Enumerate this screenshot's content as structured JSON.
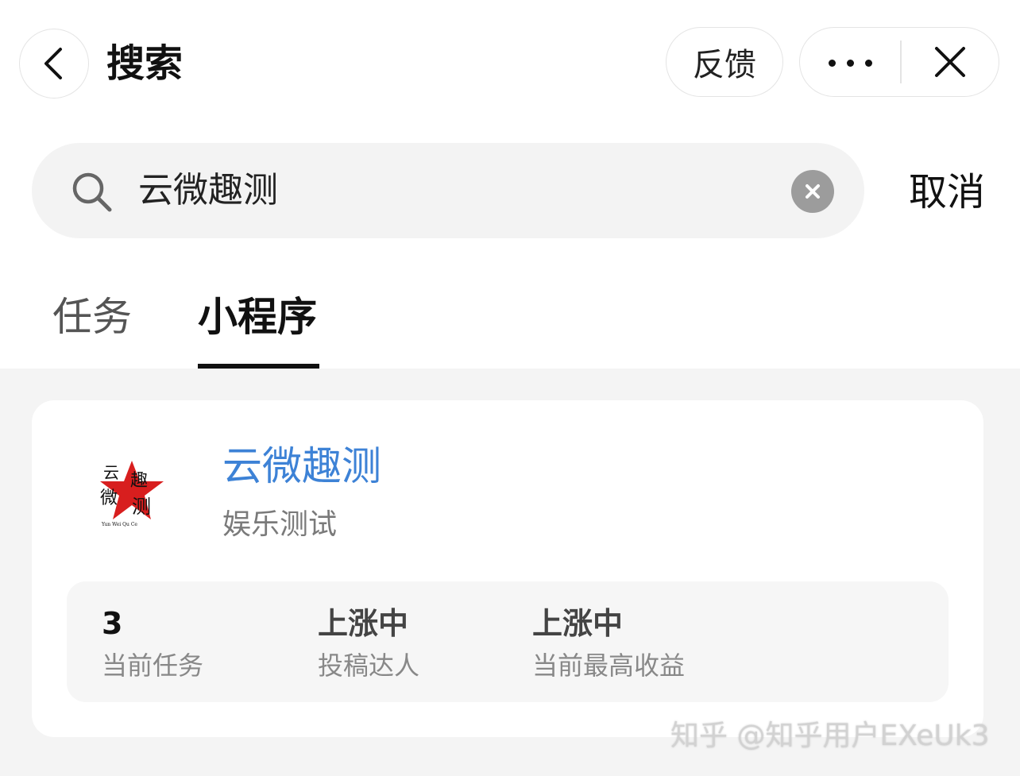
{
  "header": {
    "title": "搜索",
    "feedback_label": "反馈"
  },
  "search": {
    "query": "云微趣测",
    "cancel_label": "取消"
  },
  "tabs": [
    {
      "label": "任务",
      "active": false
    },
    {
      "label": "小程序",
      "active": true
    }
  ],
  "result": {
    "name": "云微趣测",
    "category": "娱乐测试",
    "logo_text": [
      "云",
      "微",
      "趣",
      "测"
    ],
    "logo_subtext": "Yun Wei Qu Ce",
    "stats": [
      {
        "value": "3",
        "label": "当前任务"
      },
      {
        "value": "上涨中",
        "label": "投稿达人"
      },
      {
        "value": "上涨中",
        "label": "当前最高收益"
      }
    ]
  },
  "watermark": "知乎 @知乎用户EXeUk3",
  "colors": {
    "accent": "#3d82d6",
    "logo_red": "#d81e1e"
  }
}
